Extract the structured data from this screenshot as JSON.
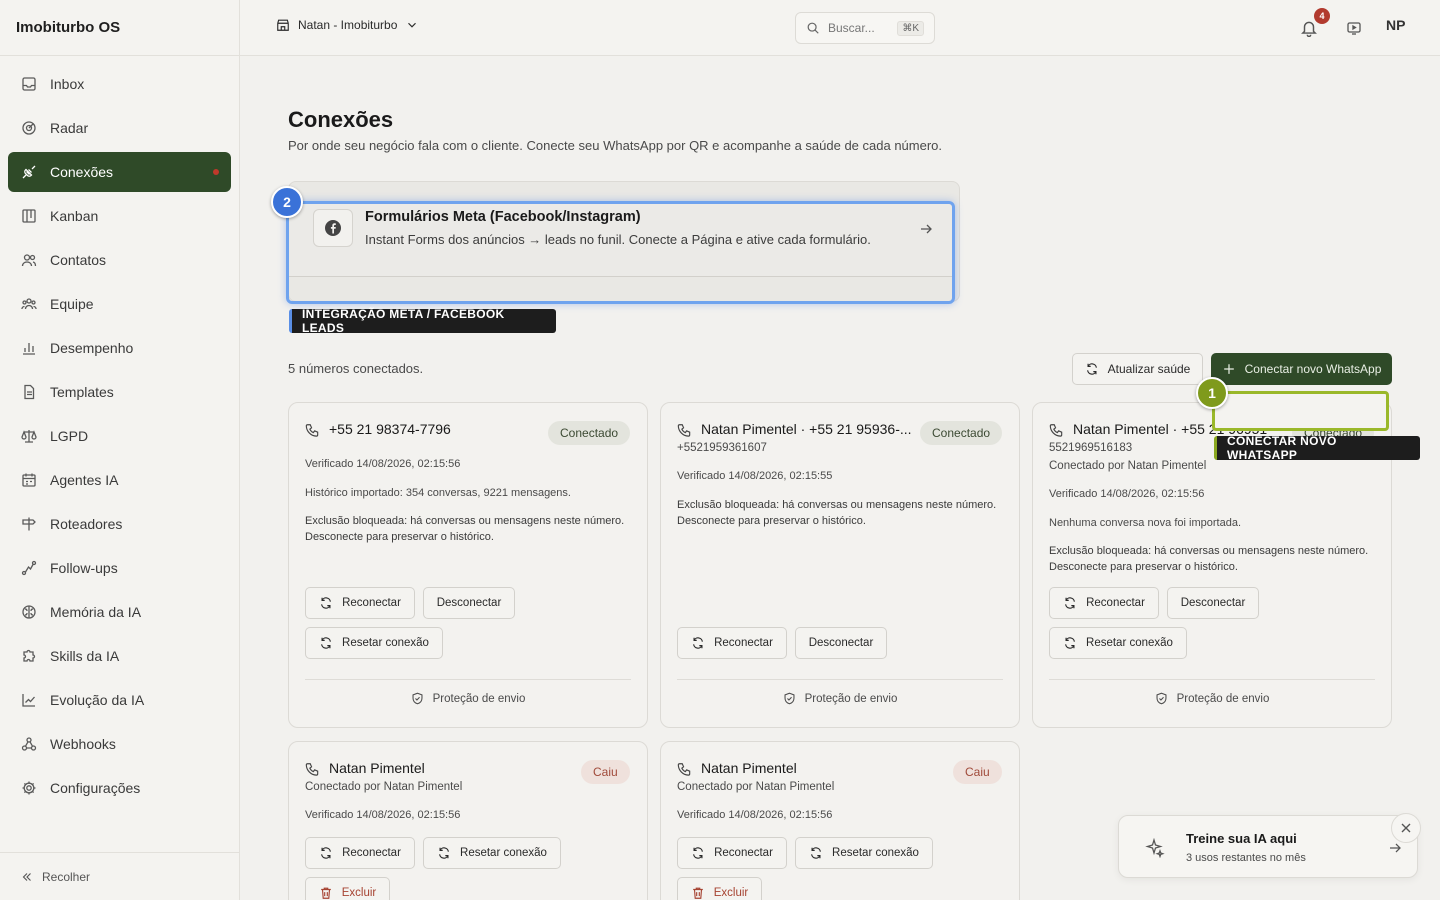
{
  "app": {
    "title": "Imobiturbo OS"
  },
  "sidebar": {
    "items": [
      {
        "label": "Inbox",
        "icon": "inbox-icon"
      },
      {
        "label": "Radar",
        "icon": "radar-icon"
      },
      {
        "label": "Conexões",
        "icon": "plug-icon",
        "active": true
      },
      {
        "label": "Kanban",
        "icon": "kanban-icon"
      },
      {
        "label": "Contatos",
        "icon": "contacts-icon"
      },
      {
        "label": "Equipe",
        "icon": "team-icon"
      },
      {
        "label": "Desempenho",
        "icon": "chart-icon"
      },
      {
        "label": "Templates",
        "icon": "document-icon"
      },
      {
        "label": "LGPD",
        "icon": "scale-icon"
      },
      {
        "label": "Agentes IA",
        "icon": "calendar-icon"
      },
      {
        "label": "Roteadores",
        "icon": "signpost-icon"
      },
      {
        "label": "Follow-ups",
        "icon": "route-icon"
      },
      {
        "label": "Memória da IA",
        "icon": "brain-icon"
      },
      {
        "label": "Skills da IA",
        "icon": "puzzle-icon"
      },
      {
        "label": "Evolução da IA",
        "icon": "trend-icon"
      },
      {
        "label": "Webhooks",
        "icon": "webhook-icon"
      },
      {
        "label": "Configurações",
        "icon": "gear-icon"
      }
    ],
    "collapse_label": "Recolher"
  },
  "topbar": {
    "workspace": "Natan - Imobiturbo",
    "search_placeholder": "Buscar...",
    "search_shortcut": "⌘K",
    "notification_count": "4",
    "avatar_initials": "NP"
  },
  "page": {
    "title": "Conexões",
    "subtitle": "Por onde seu negócio fala com o cliente. Conecte seu WhatsApp por QR e acompanhe a saúde de cada número."
  },
  "meta": {
    "title": "Formulários Meta (Facebook/Instagram)",
    "description": "Instant Forms dos anúncios → leads no funil. Conecte a Página e ative cada formulário."
  },
  "tour": {
    "step1": "1",
    "step2": "2",
    "meta_tag": "INTEGRAÇÃO META / FACEBOOK LEADS",
    "whatsapp_tag": "CONECTAR NOVO WHATSAPP"
  },
  "connections": {
    "count_label": "5 números conectados.",
    "refresh_label": "Atualizar saúde",
    "connect_label": "Conectar novo WhatsApp"
  },
  "cards": [
    {
      "title": "+55 21 98374-7796",
      "status": "Conectado",
      "verified": "Verificado 14/08/2026, 02:15:56",
      "history": "Histórico importado: 354 conversas, 9221 mensagens.",
      "blocked": "Exclusão bloqueada: há conversas ou mensagens neste número. Desconecte para preservar o histórico.",
      "btn_reconnect": "Reconectar",
      "btn_disconnect": "Desconectar",
      "btn_reset": "Resetar conexão",
      "protection": "Proteção de envio"
    },
    {
      "title": "Natan Pimentel · +55 21 95936-...",
      "status": "Conectado",
      "number": "+5521959361607",
      "verified": "Verificado 14/08/2026, 02:15:55",
      "blocked": "Exclusão bloqueada: há conversas ou mensagens neste número. Desconecte para preservar o histórico.",
      "btn_reconnect": "Reconectar",
      "btn_disconnect": "Desconectar",
      "protection": "Proteção de envio"
    },
    {
      "title": "Natan Pimentel · +55 21 96951-",
      "status": "Conectado",
      "number": "5521969516183",
      "connected_by": "Conectado por Natan Pimentel",
      "verified": "Verificado 14/08/2026, 02:15:56",
      "history": "Nenhuma conversa nova foi importada.",
      "blocked": "Exclusão bloqueada: há conversas ou mensagens neste número. Desconecte para preservar o histórico.",
      "btn_reconnect": "Reconectar",
      "btn_disconnect": "Desconectar",
      "btn_reset": "Resetar conexão",
      "protection": "Proteção de envio"
    },
    {
      "title": "Natan Pimentel",
      "status": "Caiu",
      "connected_by": "Conectado por Natan Pimentel",
      "verified": "Verificado 14/08/2026, 02:15:56",
      "btn_reconnect": "Reconectar",
      "btn_reset": "Resetar conexão",
      "btn_delete": "Excluir"
    },
    {
      "title": "Natan Pimentel",
      "status": "Caiu",
      "connected_by": "Conectado por Natan Pimentel",
      "verified": "Verificado 14/08/2026, 02:15:56",
      "btn_reconnect": "Reconectar",
      "btn_reset": "Resetar conexão",
      "btn_delete": "Excluir"
    }
  ],
  "toast": {
    "title": "Treine sua IA aqui",
    "subtitle": "3 usos restantes no mês"
  },
  "colors": {
    "accent": "#2f4a28",
    "danger": "#b23a2e",
    "tour_blue": "#3a72d8",
    "tour_green": "#7f9a1c"
  }
}
